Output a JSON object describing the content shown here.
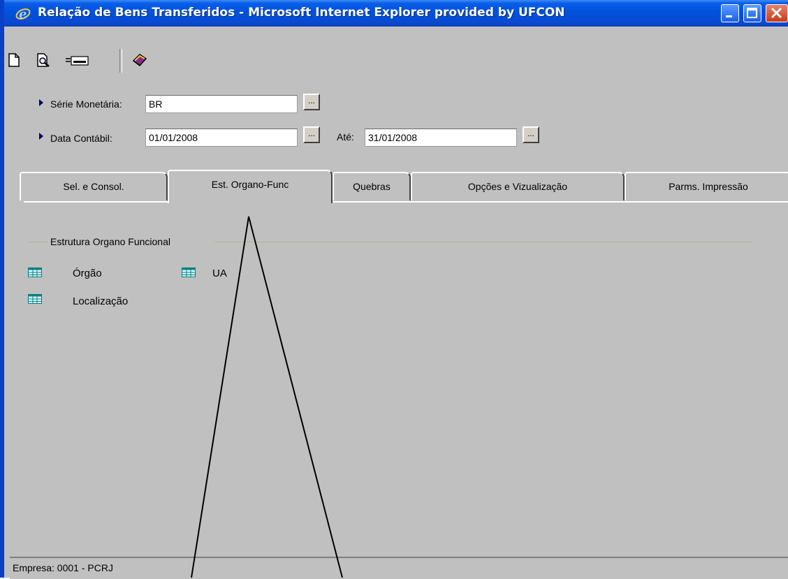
{
  "window": {
    "title": "Relação de Bens Transferidos - Microsoft Internet Explorer provided by UFCON",
    "title_icon": "ie-logo-icon",
    "controls": [
      "minimize-icon",
      "maximize-icon",
      "close-icon"
    ]
  },
  "toolbar": {
    "items": [
      "new-document-icon",
      "print-preview-icon",
      "print-icon",
      "help-book-icon"
    ]
  },
  "form": {
    "serie_monetaria": {
      "label": "Série Monetária:",
      "value": "BR",
      "lookup_label": "..."
    },
    "data_contabil": {
      "label": "Data Contábil:",
      "value": "01/01/2008",
      "lookup_label": "..."
    },
    "ate": {
      "label": "Até:",
      "value": "31/01/2008",
      "lookup_label": "..."
    }
  },
  "tabs": [
    {
      "label": "Sel. e Consol.",
      "active": false
    },
    {
      "label": "Est. Organo-Func",
      "active": true
    },
    {
      "label": "Quebras",
      "active": false
    },
    {
      "label": "Opções e Vizualização",
      "active": false
    },
    {
      "label": "Parms. Impressão",
      "active": false
    }
  ],
  "group": {
    "title": "Estrutura Organo Funcional",
    "items": [
      "Órgão",
      "UA",
      "Localização"
    ]
  },
  "status": {
    "text": "Empresa: 0001 - PCRJ"
  },
  "colors": {
    "titlebar": "#0051dd",
    "background": "#c0c0c0",
    "group_line": "#b8b098"
  }
}
